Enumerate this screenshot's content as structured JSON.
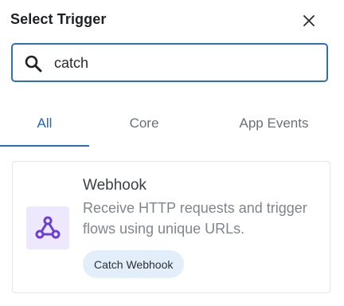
{
  "dialog": {
    "title": "Select Trigger",
    "close_icon": "close-icon"
  },
  "search": {
    "value": "catch",
    "icon": "search-icon"
  },
  "tabs": [
    {
      "label": "All",
      "active": true
    },
    {
      "label": "Core",
      "active": false
    },
    {
      "label": "App Events",
      "active": false
    }
  ],
  "results": [
    {
      "name": "Webhook",
      "description": "Receive HTTP requests and trigger flows using unique URLs.",
      "icon": "webhook-icon",
      "icon_color": "#6b3fd4",
      "triggers": [
        "Catch Webhook"
      ]
    }
  ],
  "colors": {
    "accent": "#1c66c7",
    "search_border": "#2f6fba",
    "chip_bg": "#e3eefb"
  }
}
